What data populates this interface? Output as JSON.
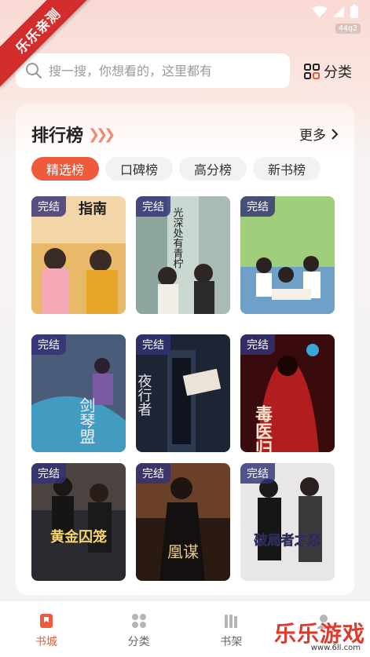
{
  "watermark": {
    "ribbon": "乐乐亲测",
    "brand": "乐乐游戏",
    "url": "www.6ll.com"
  },
  "status_bar": {
    "network_badge": "44q2"
  },
  "search": {
    "placeholder": "搜一搜，你想看的，这里都有"
  },
  "category_button": {
    "label": "分类"
  },
  "ranking": {
    "title": "排行榜",
    "more_label": "更多",
    "tabs": [
      {
        "label": "精选榜",
        "active": true
      },
      {
        "label": "口碑榜",
        "active": false
      },
      {
        "label": "高分榜",
        "active": false
      },
      {
        "label": "新书榜",
        "active": false
      }
    ],
    "books": [
      {
        "badge": "完结",
        "cover_text": "指南",
        "theme": "palace"
      },
      {
        "badge": "完结",
        "cover_text": "光深处有青柠",
        "theme": "campus-green"
      },
      {
        "badge": "完结",
        "cover_text": "",
        "theme": "classroom"
      },
      {
        "badge": "完结",
        "cover_text": "剑琴盟",
        "theme": "wuxia"
      },
      {
        "badge": "完结",
        "cover_text": "夜行者",
        "theme": "night"
      },
      {
        "badge": "完结",
        "cover_text": "毒医归来",
        "theme": "red"
      },
      {
        "badge": "完结",
        "cover_text": "黄金囚笼",
        "theme": "gold"
      },
      {
        "badge": "完结",
        "cover_text": "凰谋",
        "theme": "dark-gold"
      },
      {
        "badge": "完结",
        "cover_text": "破局者之恋",
        "theme": "bw"
      }
    ]
  },
  "tabbar": [
    {
      "label": "书城",
      "icon": "bookmark-icon",
      "active": true
    },
    {
      "label": "分类",
      "icon": "grid-icon",
      "active": false
    },
    {
      "label": "书架",
      "icon": "bookshelf-icon",
      "active": false
    },
    {
      "label": "",
      "icon": "profile-icon",
      "active": false
    }
  ],
  "colors": {
    "accent": "#ee5a3b",
    "ribbon": "#d42b2b"
  }
}
